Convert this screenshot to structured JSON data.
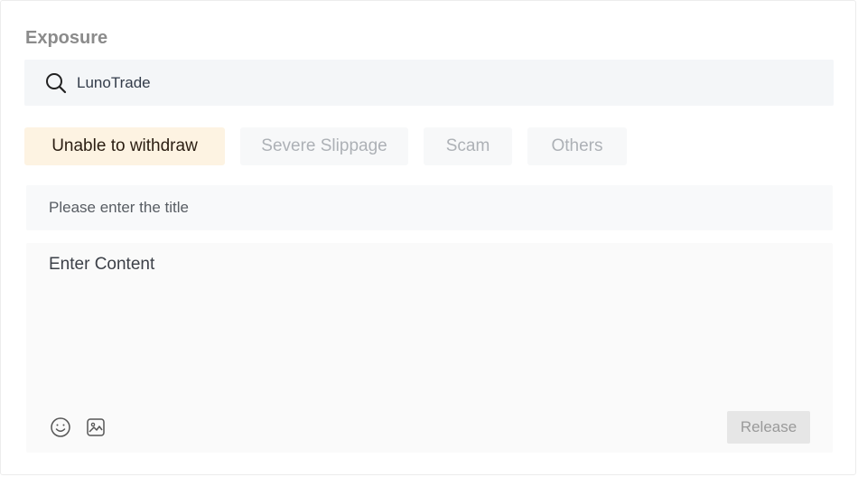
{
  "section": {
    "title": "Exposure"
  },
  "search": {
    "value": "LunoTrade",
    "icon": "search-icon"
  },
  "tabs": [
    {
      "label": "Unable to withdraw",
      "active": true
    },
    {
      "label": "Severe Slippage",
      "active": false
    },
    {
      "label": "Scam",
      "active": false
    },
    {
      "label": "Others",
      "active": false
    }
  ],
  "form": {
    "title_placeholder": "Please enter the title",
    "content_placeholder": "Enter Content",
    "release_label": "Release"
  },
  "toolbar": {
    "emoji_icon": "emoji-icon",
    "image_icon": "image-icon"
  },
  "colors": {
    "active_tab_bg": "#fdf3e2",
    "active_tab_text": "#2b1e12",
    "inactive_tab_text": "#adb1b6",
    "release_bg": "#e6e6e6"
  }
}
